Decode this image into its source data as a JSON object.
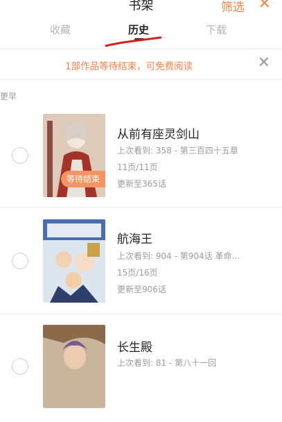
{
  "header": {
    "title": "书架",
    "filter_label": "筛选",
    "close_icon": "close-icon"
  },
  "tabs": [
    {
      "label": "收藏"
    },
    {
      "label": "历史"
    },
    {
      "label": "下载"
    }
  ],
  "notice": {
    "text": "1部作品等待结束，可免费阅读"
  },
  "section": {
    "label": "更早"
  },
  "items": [
    {
      "title": "从前有座灵剑山",
      "progress": "上次看到: 358 - 第三百四十五章",
      "pages": "11页/11页",
      "update": "更新至365话",
      "badge": "等待结束"
    },
    {
      "title": "航海王",
      "progress": "上次看到: 904 - 第904话 革命...",
      "pages": "15页/16页",
      "update": "更新至906话"
    },
    {
      "title": "长生殿",
      "progress": "上次看到: 81 - 第八十一回"
    }
  ],
  "colors": {
    "accent": "#f0824a",
    "annotation": "#d21f1f"
  }
}
